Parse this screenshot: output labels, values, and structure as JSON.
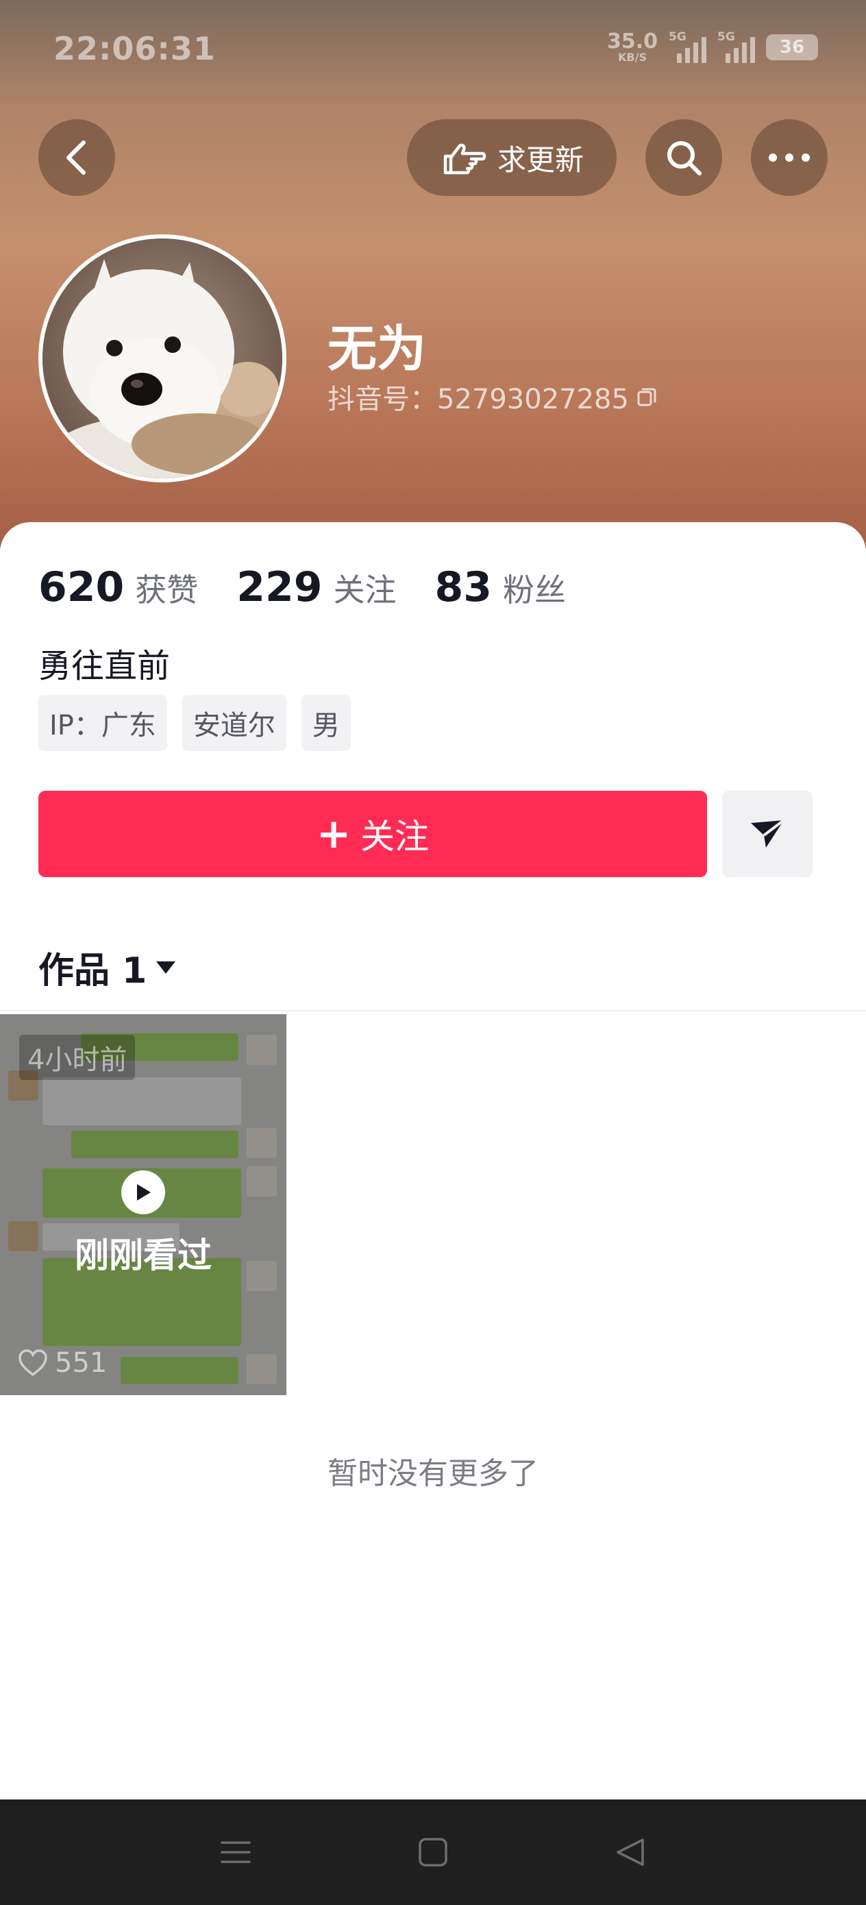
{
  "status_bar": {
    "time": "22:06:31",
    "net_speed_value": "35.0",
    "net_speed_unit": "KB/S",
    "sim1_label": "5G",
    "sim2_label": "5G",
    "battery": "36"
  },
  "header": {
    "update_label": "求更新"
  },
  "profile": {
    "nickname": "无为",
    "douyin_id": "抖音号：52793027285",
    "stats": [
      {
        "value": "620",
        "label": "获赞"
      },
      {
        "value": "229",
        "label": "关注"
      },
      {
        "value": "83",
        "label": "粉丝"
      }
    ],
    "bio": "勇往直前",
    "tags": [
      "IP：广东",
      "安道尔",
      "男"
    ]
  },
  "actions": {
    "follow_label": "关注"
  },
  "works": {
    "tab_label": "作品 1",
    "video": {
      "time_ago": "4小时前",
      "watched_label": "刚刚看过",
      "likes": "551"
    },
    "no_more": "暂时没有更多了"
  },
  "colors": {
    "accent": "#fe2c55",
    "text_primary": "#161823",
    "text_secondary": "#6f7179"
  }
}
